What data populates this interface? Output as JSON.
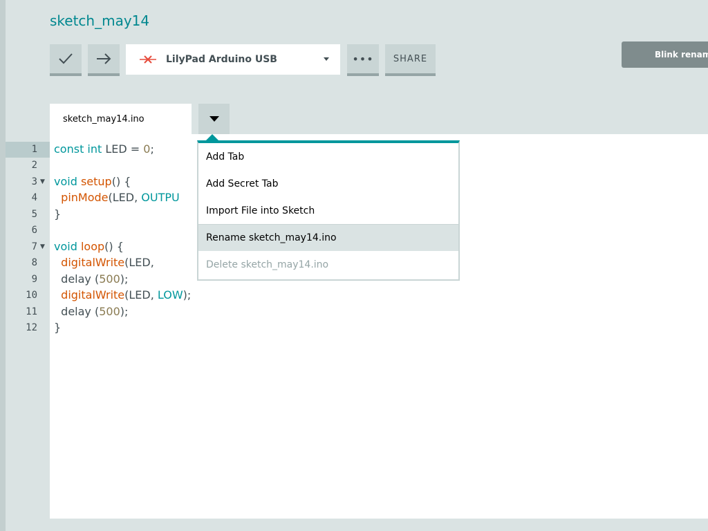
{
  "sketch": {
    "title": "sketch_may14"
  },
  "toolbar": {
    "verify_icon": "checkmark-icon",
    "upload_icon": "arrow-right-icon",
    "board_name": "LilyPad Arduino USB",
    "board_status_icon": "disconnected-x-icon",
    "more_label": "•••",
    "share_label": "SHARE"
  },
  "toast": {
    "text": "Blink renam"
  },
  "tabs": {
    "active_file": "sketch_may14.ino"
  },
  "tab_menu": {
    "items": [
      {
        "label": "Add Tab",
        "state": "normal"
      },
      {
        "label": "Add Secret Tab",
        "state": "normal"
      },
      {
        "label": "Import File into Sketch",
        "state": "normal"
      },
      {
        "label": "Rename sketch_may14.ino",
        "state": "hover"
      },
      {
        "label": "Delete sketch_may14.ino",
        "state": "disabled"
      }
    ]
  },
  "code": {
    "line_numbers": [
      "1",
      "2",
      "3",
      "4",
      "5",
      "6",
      "7",
      "8",
      "9",
      "10",
      "11",
      "12"
    ],
    "lines": [
      "const int LED = 0;",
      "",
      "void setup() {",
      "  pinMode(LED, OUTPU",
      "}",
      "",
      "void loop() {",
      "  digitalWrite(LED,",
      "  delay (500);",
      "  digitalWrite(LED, LOW);",
      "  delay (500);",
      "}"
    ]
  },
  "colors": {
    "accent": "#00979c",
    "title": "#00878f",
    "background": "#dae3e3",
    "board_error": "#e74c3c"
  }
}
